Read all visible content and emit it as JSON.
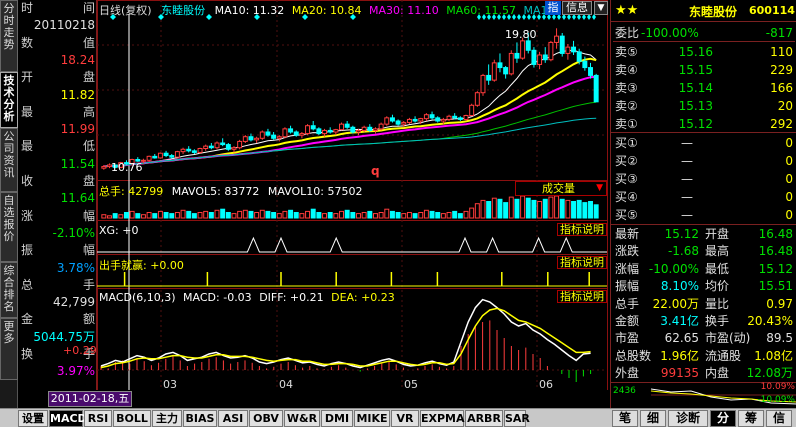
{
  "left_tabs": [
    {
      "label": "分时走势",
      "active": false
    },
    {
      "label": "技术分析",
      "active": true
    },
    {
      "label": "公司资讯",
      "active": false
    },
    {
      "label": "自选报价",
      "active": false
    },
    {
      "label": "综合排名",
      "active": false
    },
    {
      "label": "更多",
      "active": false
    }
  ],
  "info": {
    "rows": [
      {
        "k": "时",
        "v": "间",
        "vc": "#d0d0d0"
      },
      {
        "k": "",
        "v": "20110218",
        "vc": "#e0e0e0"
      },
      {
        "k": "数",
        "v": "值",
        "vc": "#d0d0d0"
      },
      {
        "k": "",
        "v": "18.24",
        "vc": "#ff3c3c"
      },
      {
        "k": "开",
        "v": "盘",
        "vc": "#d0d0d0"
      },
      {
        "k": "",
        "v": "11.82",
        "vc": "#ffff00"
      },
      {
        "k": "最",
        "v": "高",
        "vc": "#d0d0d0"
      },
      {
        "k": "",
        "v": "11.99",
        "vc": "#ff3c3c"
      },
      {
        "k": "最",
        "v": "低",
        "vc": "#d0d0d0"
      },
      {
        "k": "",
        "v": "11.54",
        "vc": "#00e000"
      },
      {
        "k": "收",
        "v": "盘",
        "vc": "#d0d0d0"
      },
      {
        "k": "",
        "v": "11.64",
        "vc": "#00e000"
      },
      {
        "k": "涨",
        "v": "幅",
        "vc": "#d0d0d0"
      },
      {
        "k": "",
        "v": "-2.10%",
        "vc": "#00e000"
      },
      {
        "k": "振",
        "v": "幅",
        "vc": "#d0d0d0"
      },
      {
        "k": "",
        "v": "3.78%",
        "vc": "#00a0ff"
      },
      {
        "k": "总",
        "v": "手",
        "vc": "#d0d0d0"
      },
      {
        "k": "",
        "v": "42,799",
        "vc": "#e0e0e0"
      },
      {
        "k": "金",
        "v": "额",
        "vc": "#d0d0d0"
      },
      {
        "k": "",
        "v": "5044.75万",
        "vc": "#00ffff"
      },
      {
        "k": "换",
        "v": "手",
        "vc": "#d0d0d0"
      },
      {
        "k": "",
        "v": "3.97%",
        "vc": "#ff00ff"
      }
    ],
    "date_label": "2011-02-18,五"
  },
  "chart_header": {
    "period": "日线(复权)",
    "name": "东睦股份",
    "ma10": "MA10: 11.32",
    "ma20": "MA20: 10.84",
    "ma30": "MA30: 11.10",
    "ma60": "MA60: 11.57",
    "ma120": "MA120: 11",
    "btn1": "指",
    "btn2": "信息",
    "btn3": "▼",
    "high_label": "19.80",
    "low_label": "10.76",
    "q_mark": "q"
  },
  "volume_header": {
    "text1": "总手: 42799",
    "text2": "MAVOL5: 83772",
    "text3": "MAVOL10: 57502",
    "dropdown": "成交量",
    "arrow": "▼"
  },
  "xg_header": {
    "text": "XG: +0",
    "btn": "指标说明"
  },
  "cjjy_header": {
    "text": "出手就赢: +0.00",
    "btn": "指标说明"
  },
  "macd_header": {
    "t1": "MACD(6,10,3)",
    "t2": "MACD: -0.03",
    "t3": "DIFF: +0.21",
    "t4": "DEA: +0.23",
    "btn": "指标说明",
    "axis": "+0.29"
  },
  "x_ticks": [
    "03",
    "04",
    "05",
    "06"
  ],
  "quote": {
    "stars": "★★",
    "name": "东睦股份",
    "code": "600114",
    "webi_label": "委比",
    "webi_pct": "-100.00%",
    "webi_val": "-817",
    "asks": [
      {
        "l": "卖⑤",
        "p": "15.16",
        "v": "110"
      },
      {
        "l": "卖④",
        "p": "15.15",
        "v": "229"
      },
      {
        "l": "卖③",
        "p": "15.14",
        "v": "166"
      },
      {
        "l": "卖②",
        "p": "15.13",
        "v": "20"
      },
      {
        "l": "卖①",
        "p": "15.12",
        "v": "292"
      }
    ],
    "bids": [
      {
        "l": "买①",
        "p": "—",
        "v": "0"
      },
      {
        "l": "买②",
        "p": "—",
        "v": "0"
      },
      {
        "l": "买③",
        "p": "—",
        "v": "0"
      },
      {
        "l": "买④",
        "p": "—",
        "v": "0"
      },
      {
        "l": "买⑤",
        "p": "—",
        "v": "0"
      }
    ],
    "stats": [
      {
        "a": "最新",
        "av": "15.12",
        "ac": "#00e000",
        "b": "开盘",
        "bv": "16.48",
        "bc": "#00e000"
      },
      {
        "a": "涨跌",
        "av": "-1.68",
        "ac": "#00e000",
        "b": "最高",
        "bv": "16.48",
        "bc": "#00e000"
      },
      {
        "a": "涨幅",
        "av": "-10.00%",
        "ac": "#00e000",
        "b": "最低",
        "bv": "15.12",
        "bc": "#00e000"
      },
      {
        "a": "振幅",
        "av": "8.10%",
        "ac": "#00ffff",
        "b": "均价",
        "bv": "15.51",
        "bc": "#00e000"
      },
      {
        "a": "总手",
        "av": "22.00万",
        "ac": "#ffff00",
        "b": "量比",
        "bv": "0.97",
        "bc": "#ffff00"
      },
      {
        "a": "金额",
        "av": "3.41亿",
        "ac": "#00ffff",
        "b": "换手",
        "bv": "20.43%",
        "bc": "#ffff00"
      },
      {
        "a": "市盈",
        "av": "62.65",
        "ac": "#e0e0e0",
        "b": "市盈(动)",
        "bv": "89.5",
        "bc": "#e0e0e0"
      },
      {
        "a": "总股数",
        "av": "1.96亿",
        "ac": "#ffff00",
        "b": "流通股",
        "bv": "1.08亿",
        "bc": "#ffff00"
      },
      {
        "a": "外盘",
        "av": "99135",
        "ac": "#ff3c3c",
        "b": "内盘",
        "bv": "12.08万",
        "bc": "#00e000"
      }
    ],
    "mini_top": "10.09%",
    "mini_bot": "-10.09%",
    "mini_vol": "2436"
  },
  "bottom_tabs": [
    "设置",
    "MACD",
    "RSI",
    "BOLL",
    "主力",
    "BIAS",
    "ASI",
    "OBV",
    "W&R",
    "DMI",
    "MIKE",
    "VR",
    "EXPMA",
    "ARBR",
    "SAR"
  ],
  "right_bottom_tabs": [
    "笔",
    "细",
    "诊断",
    "分",
    "筹",
    "信"
  ],
  "chart_data": {
    "type": "candlestick",
    "x_ticks": [
      "03",
      "04",
      "05",
      "06"
    ],
    "price_high_label": 19.8,
    "price_low_label": 10.76,
    "macd_axis_label": 0.29,
    "candles": [
      [
        10.9,
        11.1,
        10.8,
        11.0
      ],
      [
        11.0,
        11.2,
        10.9,
        11.1
      ],
      [
        11.1,
        11.1,
        10.9,
        10.95
      ],
      [
        10.95,
        11.3,
        10.9,
        11.25
      ],
      [
        11.25,
        11.4,
        11.1,
        11.2
      ],
      [
        11.2,
        11.5,
        11.1,
        11.45
      ],
      [
        11.45,
        11.6,
        11.3,
        11.35
      ],
      [
        11.35,
        11.5,
        11.2,
        11.4
      ],
      [
        11.4,
        11.7,
        11.3,
        11.65
      ],
      [
        11.65,
        11.8,
        11.5,
        11.55
      ],
      [
        11.55,
        11.9,
        11.5,
        11.85
      ],
      [
        11.85,
        12.0,
        11.6,
        11.7
      ],
      [
        11.7,
        11.8,
        11.5,
        11.6
      ],
      [
        11.6,
        12.0,
        11.6,
        11.95
      ],
      [
        11.95,
        12.2,
        11.8,
        12.1
      ],
      [
        12.1,
        12.3,
        11.9,
        12.0
      ],
      [
        12.0,
        12.1,
        11.8,
        11.9
      ],
      [
        11.9,
        12.2,
        11.8,
        12.15
      ],
      [
        12.15,
        12.4,
        12.0,
        12.3
      ],
      [
        12.3,
        12.5,
        12.1,
        12.2
      ],
      [
        12.2,
        12.6,
        12.1,
        12.5
      ],
      [
        12.5,
        12.8,
        12.3,
        12.4
      ],
      [
        12.4,
        12.5,
        12.0,
        12.1
      ],
      [
        12.1,
        12.3,
        11.9,
        12.2
      ],
      [
        12.2,
        12.7,
        12.1,
        12.6
      ],
      [
        12.6,
        13.0,
        12.5,
        12.9
      ],
      [
        12.9,
        13.1,
        12.6,
        12.7
      ],
      [
        12.7,
        12.9,
        12.5,
        12.8
      ],
      [
        12.8,
        13.3,
        12.7,
        13.2
      ],
      [
        13.2,
        13.4,
        12.9,
        13.0
      ],
      [
        13.0,
        13.2,
        12.7,
        12.8
      ],
      [
        12.8,
        13.0,
        12.6,
        12.9
      ],
      [
        12.9,
        13.5,
        12.8,
        13.4
      ],
      [
        13.4,
        13.6,
        13.1,
        13.2
      ],
      [
        13.2,
        13.3,
        12.9,
        13.0
      ],
      [
        13.0,
        13.2,
        12.8,
        13.1
      ],
      [
        13.1,
        13.7,
        13.0,
        13.6
      ],
      [
        13.6,
        13.9,
        13.3,
        13.4
      ],
      [
        13.4,
        13.5,
        13.0,
        13.1
      ],
      [
        13.1,
        13.4,
        12.9,
        13.3
      ],
      [
        13.3,
        13.5,
        13.1,
        13.2
      ],
      [
        13.2,
        13.4,
        13.0,
        13.35
      ],
      [
        13.35,
        13.8,
        13.3,
        13.7
      ],
      [
        13.7,
        13.9,
        13.4,
        13.5
      ],
      [
        13.5,
        13.6,
        13.1,
        13.2
      ],
      [
        13.2,
        13.4,
        13.0,
        13.3
      ],
      [
        13.3,
        13.6,
        13.2,
        13.5
      ],
      [
        13.5,
        13.7,
        13.2,
        13.3
      ],
      [
        13.3,
        13.5,
        13.1,
        13.4
      ],
      [
        13.4,
        13.8,
        13.3,
        13.7
      ],
      [
        13.7,
        14.2,
        13.6,
        14.1
      ],
      [
        14.1,
        14.3,
        13.8,
        13.9
      ],
      [
        13.9,
        14.0,
        13.6,
        13.7
      ],
      [
        13.7,
        13.9,
        13.5,
        13.8
      ],
      [
        13.8,
        14.1,
        13.7,
        14.0
      ],
      [
        14.0,
        14.2,
        13.8,
        13.9
      ],
      [
        13.9,
        14.1,
        13.7,
        14.05
      ],
      [
        14.05,
        14.4,
        13.9,
        14.3
      ],
      [
        14.3,
        14.5,
        14.0,
        14.1
      ],
      [
        14.1,
        14.2,
        13.8,
        13.9
      ],
      [
        13.9,
        14.1,
        13.7,
        14.0
      ],
      [
        14.0,
        14.3,
        13.9,
        14.2
      ],
      [
        14.2,
        14.4,
        14.0,
        14.1
      ],
      [
        14.1,
        14.2,
        13.9,
        14.0
      ],
      [
        14.0,
        14.3,
        13.9,
        14.25
      ],
      [
        14.25,
        15.0,
        14.2,
        14.9
      ],
      [
        14.9,
        15.8,
        14.8,
        15.7
      ],
      [
        15.7,
        16.9,
        15.5,
        16.8
      ],
      [
        16.8,
        17.5,
        16.2,
        16.5
      ],
      [
        16.5,
        17.8,
        16.4,
        17.6
      ],
      [
        17.6,
        18.2,
        17.0,
        17.3
      ],
      [
        17.3,
        17.4,
        16.6,
        16.9
      ],
      [
        16.9,
        18.4,
        16.8,
        18.2
      ],
      [
        18.2,
        18.9,
        17.6,
        17.9
      ],
      [
        17.9,
        19.2,
        17.8,
        19.0
      ],
      [
        19.0,
        19.5,
        18.2,
        18.4
      ],
      [
        18.4,
        18.6,
        17.3,
        17.5
      ],
      [
        17.5,
        18.3,
        17.2,
        18.1
      ],
      [
        18.1,
        18.6,
        17.6,
        17.8
      ],
      [
        17.8,
        19.0,
        17.7,
        18.9
      ],
      [
        18.9,
        19.8,
        18.5,
        19.3
      ],
      [
        19.3,
        19.5,
        18.0,
        18.2
      ],
      [
        18.2,
        18.8,
        17.8,
        18.6
      ],
      [
        18.6,
        19.0,
        18.1,
        18.3
      ],
      [
        18.3,
        18.5,
        17.5,
        17.7
      ],
      [
        17.7,
        18.0,
        17.1,
        17.3
      ],
      [
        17.3,
        17.6,
        16.6,
        16.8
      ],
      [
        16.8,
        16.9,
        15.12,
        15.12
      ]
    ],
    "ma_series": [
      {
        "color": "#ffffff"
      },
      {
        "color": "#ffff00"
      },
      {
        "color": "#ff00ff"
      },
      {
        "color": "#00c000"
      },
      {
        "color": "#00bfbf"
      }
    ],
    "volume": [
      3,
      2,
      4,
      3,
      5,
      6,
      4,
      3,
      5,
      4,
      6,
      5,
      4,
      5,
      7,
      6,
      4,
      5,
      6,
      5,
      7,
      8,
      5,
      4,
      6,
      7,
      6,
      5,
      7,
      6,
      5,
      4,
      6,
      7,
      5,
      4,
      6,
      8,
      5,
      4,
      5,
      4,
      6,
      7,
      5,
      4,
      5,
      6,
      4,
      5,
      8,
      6,
      5,
      4,
      5,
      4,
      5,
      7,
      6,
      5,
      4,
      5,
      6,
      4,
      6,
      9,
      13,
      16,
      15,
      18,
      17,
      14,
      19,
      17,
      20,
      18,
      16,
      15,
      17,
      19,
      20,
      17,
      16,
      15,
      16,
      14,
      15,
      12
    ],
    "xg_peaks": [
      34,
      40,
      52,
      80,
      86,
      96,
      102
    ],
    "cjjy_markers": [
      6,
      24,
      40,
      52,
      64,
      74,
      88,
      98,
      107
    ],
    "macd": [
      0.05,
      0.02,
      0.1,
      0.12,
      0.08,
      0.15,
      0.11,
      0.06,
      0.09,
      0.14,
      0.18,
      0.12,
      0.05,
      0.08,
      0.1,
      0.14,
      0.16,
      0.12,
      0.08,
      0.1,
      0.12,
      0.09,
      0.05,
      0.02,
      0.04,
      0.08,
      0.1,
      0.06,
      0.03,
      0.05,
      0.02,
      0.01,
      0.04,
      0.06,
      0.03,
      0.0,
      -0.02,
      0.02,
      0.05,
      0.08,
      0.1,
      0.07,
      0.03,
      0.0,
      0.02,
      0.05,
      0.07,
      0.04,
      0.02,
      0.05,
      0.3,
      0.45,
      0.55,
      0.6,
      0.62,
      0.5,
      0.4,
      0.3,
      0.25,
      0.28,
      0.2,
      0.15,
      0.05,
      0.0,
      -0.05,
      -0.1,
      -0.15,
      -0.08,
      -0.05
    ],
    "diff": [
      0.05,
      0.08,
      0.12,
      0.1,
      0.14,
      0.18,
      0.16,
      0.12,
      0.15,
      0.2,
      0.22,
      0.18,
      0.12,
      0.14,
      0.16,
      0.2,
      0.22,
      0.18,
      0.15,
      0.16,
      0.18,
      0.15,
      0.1,
      0.08,
      0.1,
      0.13,
      0.15,
      0.12,
      0.09,
      0.1,
      0.07,
      0.05,
      0.08,
      0.1,
      0.08,
      0.05,
      0.03,
      0.06,
      0.09,
      0.12,
      0.14,
      0.11,
      0.07,
      0.05,
      0.06,
      0.09,
      0.11,
      0.08,
      0.06,
      0.1,
      0.35,
      0.6,
      0.78,
      0.88,
      0.85,
      0.78,
      0.7,
      0.6,
      0.55,
      0.58,
      0.5,
      0.45,
      0.38,
      0.32,
      0.25,
      0.18,
      0.12,
      0.2,
      0.21
    ],
    "dea": [
      0.03,
      0.05,
      0.08,
      0.09,
      0.11,
      0.14,
      0.15,
      0.14,
      0.14,
      0.16,
      0.18,
      0.18,
      0.16,
      0.15,
      0.15,
      0.17,
      0.19,
      0.19,
      0.17,
      0.17,
      0.17,
      0.16,
      0.14,
      0.12,
      0.11,
      0.12,
      0.13,
      0.13,
      0.11,
      0.11,
      0.09,
      0.07,
      0.07,
      0.08,
      0.08,
      0.07,
      0.05,
      0.05,
      0.07,
      0.09,
      0.11,
      0.11,
      0.09,
      0.07,
      0.06,
      0.07,
      0.09,
      0.09,
      0.07,
      0.08,
      0.2,
      0.38,
      0.55,
      0.68,
      0.75,
      0.77,
      0.74,
      0.68,
      0.62,
      0.6,
      0.56,
      0.52,
      0.46,
      0.4,
      0.34,
      0.28,
      0.22,
      0.22,
      0.23
    ]
  }
}
